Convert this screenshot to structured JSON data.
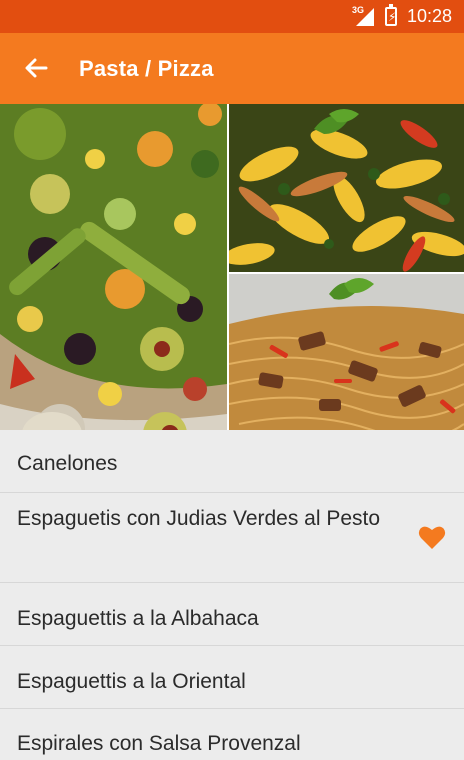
{
  "status_bar": {
    "network": "3G",
    "time": "10:28",
    "icons": [
      "signal-icon",
      "battery-charging-icon"
    ]
  },
  "app_bar": {
    "title": "Pasta / Pizza",
    "back_icon": "arrow-back-icon",
    "color": "#f47a1f"
  },
  "hero_images": [
    "vegetable-pizza-photo",
    "fusilli-pasta-photo",
    "stir-fried-noodles-photo"
  ],
  "recipes": [
    {
      "title": "Canelones",
      "favorite": false
    },
    {
      "title": "Espaguetis con Judias Verdes al Pesto",
      "favorite": true
    },
    {
      "title": "Espaguettis a la Albahaca",
      "favorite": false
    },
    {
      "title": "Espaguettis a la Oriental",
      "favorite": false
    },
    {
      "title": "Espirales con Salsa Provenzal",
      "favorite": false
    }
  ],
  "favorite_icon": "heart-icon",
  "colors": {
    "status_bar": "#e24e10",
    "accent": "#f47a1f",
    "list_bg": "#ececec"
  }
}
